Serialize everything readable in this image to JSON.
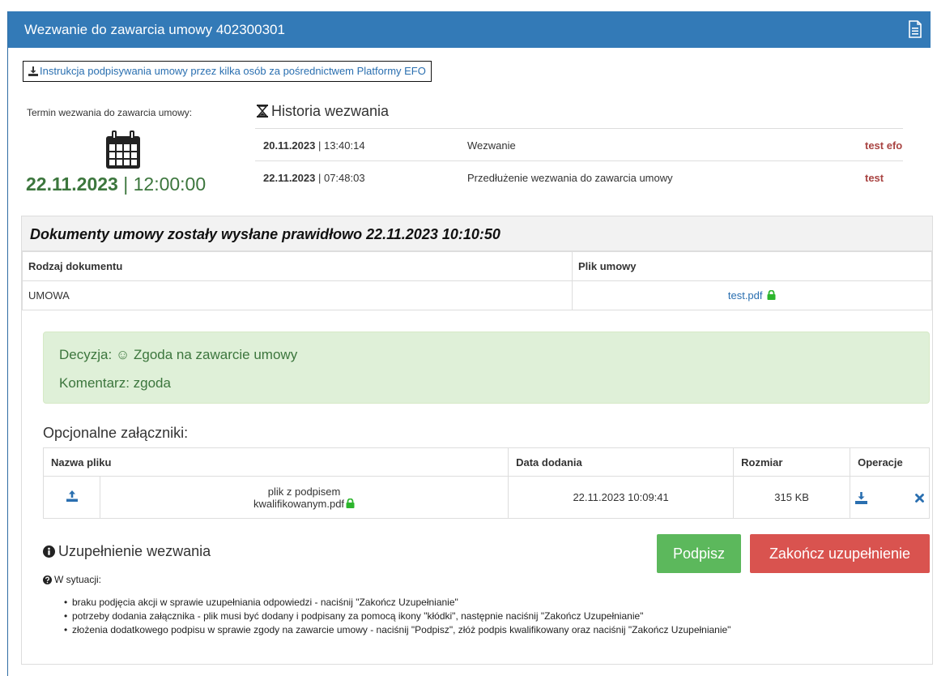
{
  "header": {
    "title": "Wezwanie do zawarcia umowy 402300301",
    "icon": "file-text-icon"
  },
  "instruction_link": {
    "label": "Instrukcja podpisywania umowy przez kilka osób za pośrednictwem Platformy EFO",
    "icon": "download-icon"
  },
  "deadline": {
    "label": "Termin wezwania do zawarcia umowy:",
    "date": "22.11.2023",
    "separator": "|",
    "time": "12:00:00",
    "icon": "calendar-icon"
  },
  "history": {
    "title": "Historia wezwania",
    "icon": "hourglass-icon",
    "rows": [
      {
        "date": "20.11.2023",
        "time": "13:40:14",
        "description": "Wezwanie",
        "user": "test efo"
      },
      {
        "date": "22.11.2023",
        "time": "07:48:03",
        "description": "Przedłużenie wezwania do zawarcia umowy",
        "user": "test"
      }
    ]
  },
  "documents": {
    "heading": "Dokumenty umowy zostały wysłane prawidłowo 22.11.2023 10:10:50",
    "columns": [
      "Rodzaj dokumentu",
      "Plik umowy"
    ],
    "rows": [
      {
        "type": "UMOWA",
        "file": "test.pdf"
      }
    ]
  },
  "decision": {
    "line1": "Decyzja: ☺ Zgoda na zawarcie umowy",
    "line2": "Komentarz: zgoda"
  },
  "attachments": {
    "title": "Opcjonalne załączniki:",
    "columns": [
      "Nazwa pliku",
      "Data dodania",
      "Rozmiar",
      "Operacje"
    ],
    "rows": [
      {
        "name_line1": "plik z podpisem",
        "name_line2": "kwalifikowanym.pdf",
        "date": "22.11.2023 10:09:41",
        "size": "315 KB"
      }
    ]
  },
  "completion": {
    "title": "Uzupełnienie wezwania",
    "sign_button": "Podpisz",
    "finish_button": "Zakończ uzupełnienie",
    "situation_label": "W sytuacji:",
    "bullets": [
      "braku podjęcia akcji w sprawie uzupełniania odpowiedzi - naciśnij \"Zakończ Uzupełnianie\"",
      "potrzeby dodania załącznika - plik musi być dodany i podpisany za pomocą ikony \"kłódki\", następnie naciśnij \"Zakończ Uzupełnianie\"",
      "złożenia dodatkowego podpisu w sprawie zgody na zawarcie umowy - naciśnij \"Podpisz\", złóż podpis kwalifikowany oraz naciśnij \"Zakończ Uzupełnianie\""
    ]
  },
  "colors": {
    "primary": "#337ab7",
    "success": "#5cb85c",
    "danger": "#d9534f",
    "success_text": "#3c763d",
    "user_text": "#a94442"
  }
}
